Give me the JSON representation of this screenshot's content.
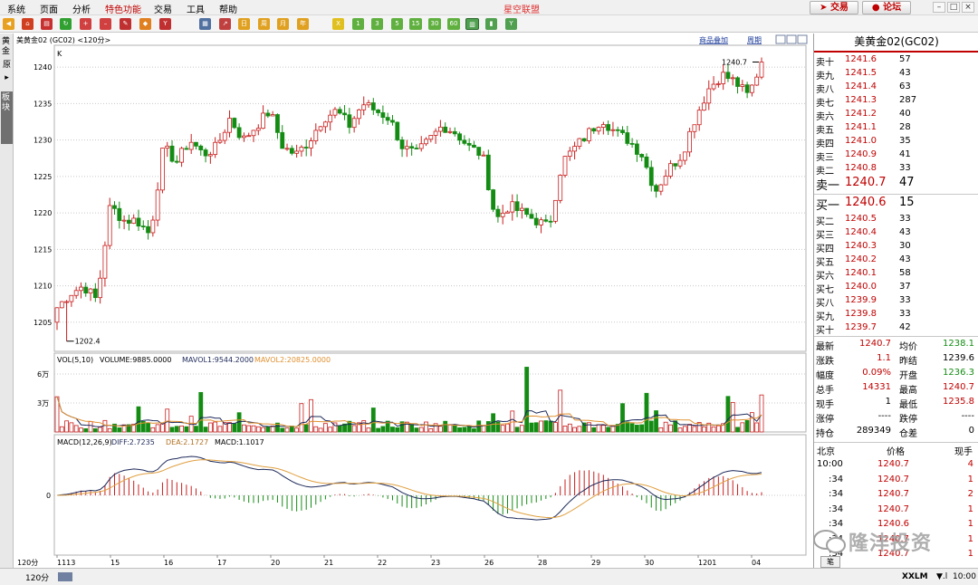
{
  "window": {
    "app_title": "星空联盟",
    "menu": [
      "系统",
      "页面",
      "分析",
      "特色功能",
      "交易",
      "工具",
      "帮助"
    ],
    "trade_button": "交易",
    "forum_button": "论坛"
  },
  "toolbar": {
    "icons": [
      "back-icon",
      "home-icon",
      "folder-icon",
      "refresh-icon",
      "zoom-in-icon",
      "zoom-out-icon",
      "pen-icon",
      "bucket-icon",
      "filter-icon",
      "grid-icon",
      "chart-icon",
      "day-icon",
      "week-icon",
      "month-icon",
      "year-icon",
      "x-icon",
      "1min-icon",
      "3min-icon",
      "5min-icon",
      "15min-icon",
      "30min-icon",
      "60min-icon",
      "kline-icon",
      "tick-icon",
      "multi-icon"
    ],
    "period_labels": [
      "日",
      "周",
      "月",
      "年",
      "X",
      "1",
      "3",
      "5",
      "15",
      "30",
      "60"
    ]
  },
  "left_tabs": {
    "gold_tab": "黄金",
    "source_tab": "原",
    "sector_tab": "板块"
  },
  "chart": {
    "header": "美黄金02 (GC02)  <120分>",
    "link_overlay": "商品叠加",
    "link_period": "周期",
    "k_label": "K",
    "high_label": "1240.7",
    "low_label": "1202.4",
    "period_label": "120分",
    "vol_header_prefix": "VOL(5,10)",
    "vol_value": "VOLUME:9885.0000",
    "mavol1": "MAVOL1:9544.2000",
    "mavol2": "MAVOL2:20825.0000",
    "macd_prefix": "MACD(12,26,9)",
    "diff": "DIFF:2.7235",
    "dea": "DEA:2.1727",
    "macd_val": "MACD:1.1017",
    "colors": {
      "up": "#c81e1e",
      "down": "#148c14",
      "diff": "#1e2a5a",
      "dea": "#e0a040",
      "mavol2": "#e09030"
    }
  },
  "chart_data": {
    "type": "candlestick",
    "price_ylim": [
      1201,
      1243
    ],
    "price_ticks": [
      1205,
      1210,
      1215,
      1220,
      1225,
      1230,
      1235,
      1240
    ],
    "vol_ticks": [
      "3万",
      "6万"
    ],
    "macd_ticks": [
      "0"
    ],
    "x_ticks": [
      "1113",
      "15",
      "16",
      "17",
      "20",
      "21",
      "22",
      "23",
      "26",
      "28",
      "29",
      "30",
      "1201",
      "04"
    ],
    "high": 1240.7,
    "low": 1202.4,
    "key_prices": [
      1207,
      1209,
      1210,
      1208,
      1221,
      1219,
      1219,
      1217,
      1229,
      1227,
      1230,
      1228,
      1229,
      1233,
      1230,
      1232,
      1234,
      1229,
      1228,
      1230,
      1233,
      1234,
      1232,
      1235,
      1234,
      1233,
      1229,
      1228,
      1230,
      1232,
      1231,
      1229,
      1228,
      1219,
      1221,
      1220,
      1219,
      1218,
      1227,
      1229,
      1231,
      1233,
      1231,
      1230,
      1228,
      1223,
      1226,
      1228,
      1233,
      1237,
      1239,
      1238,
      1236,
      1240.7
    ]
  },
  "orderbook": {
    "title": "美黄金02(GC02)",
    "asks": [
      {
        "label": "卖十",
        "price": "1241.6",
        "vol": "57"
      },
      {
        "label": "卖九",
        "price": "1241.5",
        "vol": "43"
      },
      {
        "label": "卖八",
        "price": "1241.4",
        "vol": "63"
      },
      {
        "label": "卖七",
        "price": "1241.3",
        "vol": "287"
      },
      {
        "label": "卖六",
        "price": "1241.2",
        "vol": "40"
      },
      {
        "label": "卖五",
        "price": "1241.1",
        "vol": "28"
      },
      {
        "label": "卖四",
        "price": "1241.0",
        "vol": "35"
      },
      {
        "label": "卖三",
        "price": "1240.9",
        "vol": "41"
      },
      {
        "label": "卖二",
        "price": "1240.8",
        "vol": "33"
      },
      {
        "label": "卖一",
        "price": "1240.7",
        "vol": "47"
      }
    ],
    "bids": [
      {
        "label": "买一",
        "price": "1240.6",
        "vol": "15"
      },
      {
        "label": "买二",
        "price": "1240.5",
        "vol": "33"
      },
      {
        "label": "买三",
        "price": "1240.4",
        "vol": "43"
      },
      {
        "label": "买四",
        "price": "1240.3",
        "vol": "30"
      },
      {
        "label": "买五",
        "price": "1240.2",
        "vol": "43"
      },
      {
        "label": "买六",
        "price": "1240.1",
        "vol": "58"
      },
      {
        "label": "买七",
        "price": "1240.0",
        "vol": "37"
      },
      {
        "label": "买八",
        "price": "1239.9",
        "vol": "33"
      },
      {
        "label": "买九",
        "price": "1239.8",
        "vol": "33"
      },
      {
        "label": "买十",
        "price": "1239.7",
        "vol": "42"
      }
    ]
  },
  "stats": [
    {
      "l1": "最新",
      "v1": "1240.7",
      "l2": "均价",
      "v2": "1238.1"
    },
    {
      "l1": "涨跌",
      "v1": "1.1",
      "l2": "昨结",
      "v2": "1239.6"
    },
    {
      "l1": "幅度",
      "v1": "0.09%",
      "l2": "开盘",
      "v2": "1236.3"
    },
    {
      "l1": "总手",
      "v1": "14331",
      "l2": "最高",
      "v2": "1240.7"
    },
    {
      "l1": "现手",
      "v1": "1",
      "l2": "最低",
      "v2": "1235.8"
    },
    {
      "l1": "涨停",
      "v1": "----",
      "l2": "跌停",
      "v2": "----"
    },
    {
      "l1": "持仓",
      "v1": "289349",
      "l2": "仓差",
      "v2": "0"
    }
  ],
  "ticks": {
    "col_time": "北京",
    "col_price": "价格",
    "col_vol": "现手",
    "rows": [
      {
        "time": "10:00",
        "price": "1240.7",
        "vol": "4"
      },
      {
        "time": ":34",
        "price": "1240.7",
        "vol": "1"
      },
      {
        "time": ":34",
        "price": "1240.7",
        "vol": "2"
      },
      {
        "time": ":34",
        "price": "1240.7",
        "vol": "1"
      },
      {
        "time": ":34",
        "price": "1240.6",
        "vol": "1"
      },
      {
        "time": ":34",
        "price": "1240.7",
        "vol": "1"
      },
      {
        "time": ":34",
        "price": "1240.7",
        "vol": "1"
      }
    ],
    "note_button": "笔"
  },
  "watermark": "隆沣投资",
  "status": {
    "left": "120分",
    "xxlm": "XXLM",
    "time": "10:00"
  }
}
